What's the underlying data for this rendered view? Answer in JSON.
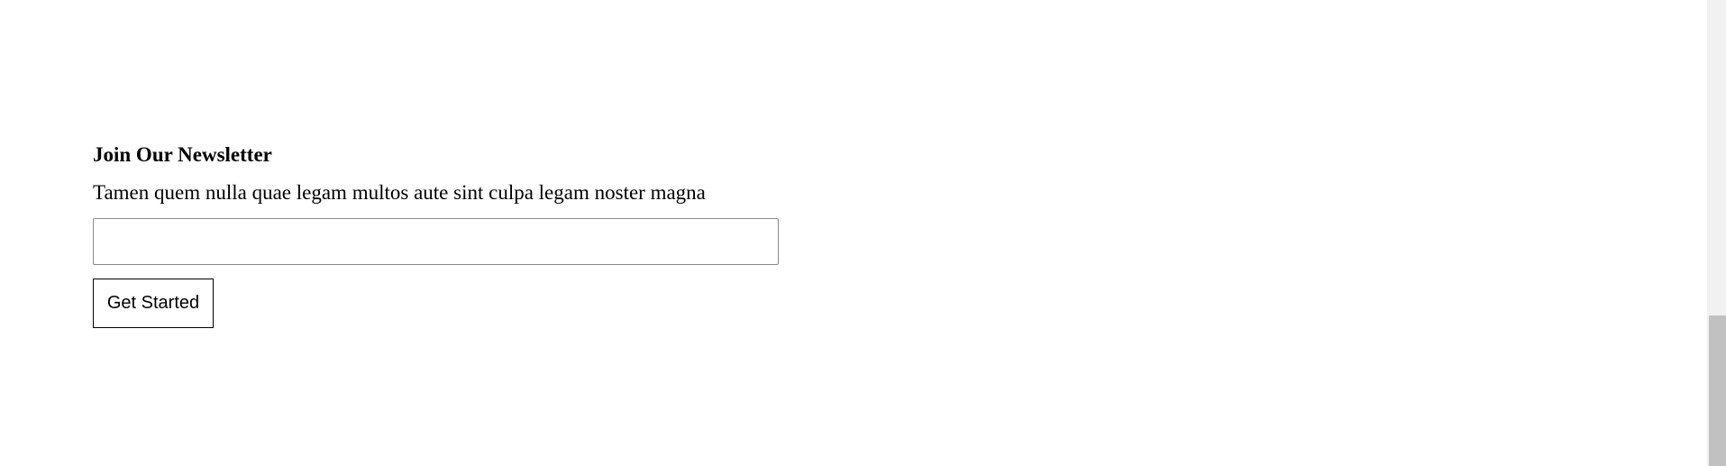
{
  "newsletter": {
    "title": "Join Our Newsletter",
    "description": "Tamen quem nulla quae legam multos aute sint culpa legam noster magna",
    "email_value": "",
    "email_placeholder": "",
    "button_label": "Get Started"
  },
  "colors": {
    "background": "#ffffff",
    "text": "#000000",
    "input_border": "#8a8a8a",
    "scrollbar_track": "#f1f1f1",
    "scrollbar_thumb": "#c1c1c1"
  }
}
